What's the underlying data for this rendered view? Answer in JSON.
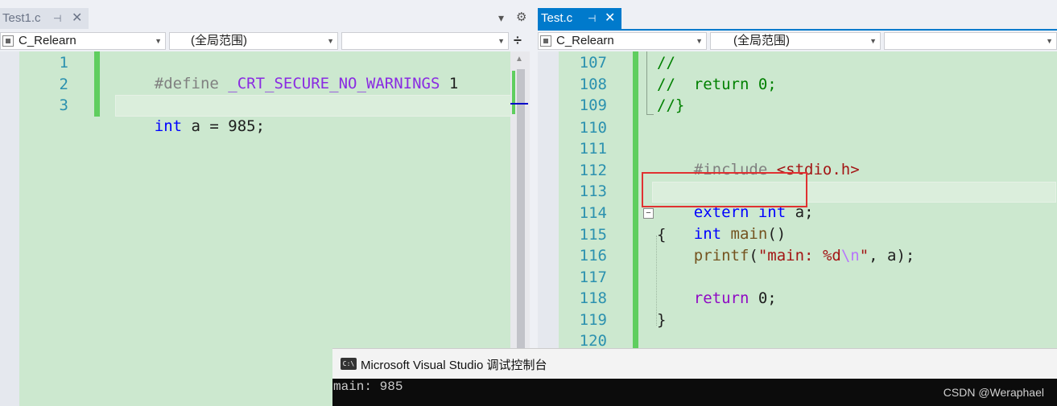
{
  "left_pane": {
    "tab": {
      "title": "Test1.c",
      "pin": "⊣",
      "close": "✕"
    },
    "tab_overflow": "▾",
    "tab_settings": "⚙",
    "nav": {
      "project": "C_Relearn",
      "scope": "(全局范围)",
      "member": ""
    },
    "split_icon": "÷",
    "lines": [
      {
        "n": "1",
        "text": "#define _CRT_SECURE_NO_WARNINGS 1"
      },
      {
        "n": "2",
        "text": ""
      },
      {
        "n": "3",
        "text": "int a = 985;"
      }
    ]
  },
  "right_pane": {
    "tab": {
      "title": "Test.c",
      "pin": "⊣",
      "close": "✕"
    },
    "nav": {
      "project": "C_Relearn",
      "scope": "(全局范围)",
      "member": ""
    },
    "lines": [
      {
        "n": "107",
        "text": "//"
      },
      {
        "n": "108",
        "text": "//  return 0;"
      },
      {
        "n": "109",
        "text": "//}"
      },
      {
        "n": "110",
        "text": ""
      },
      {
        "n": "111",
        "text": "#include <stdio.h>"
      },
      {
        "n": "112",
        "text": ""
      },
      {
        "n": "113",
        "text": "extern int a;"
      },
      {
        "n": "114",
        "text": "int main()"
      },
      {
        "n": "115",
        "text": "{"
      },
      {
        "n": "116",
        "text": "    printf(\"main: %d\\n\", a);"
      },
      {
        "n": "117",
        "text": ""
      },
      {
        "n": "118",
        "text": "    return 0;"
      },
      {
        "n": "119",
        "text": "}"
      },
      {
        "n": "120",
        "text": ""
      }
    ],
    "collapse_icon": "−"
  },
  "console": {
    "icon_text": "C:\\",
    "title": "Microsoft Visual Studio 调试控制台",
    "output": "main: 985"
  },
  "watermark": "CSDN @Weraphael",
  "colors": {
    "editor_bg": "#cce8cf",
    "accent_tab": "#007acc",
    "change_bar": "#5fce5f",
    "highlight_box": "#e03131"
  }
}
